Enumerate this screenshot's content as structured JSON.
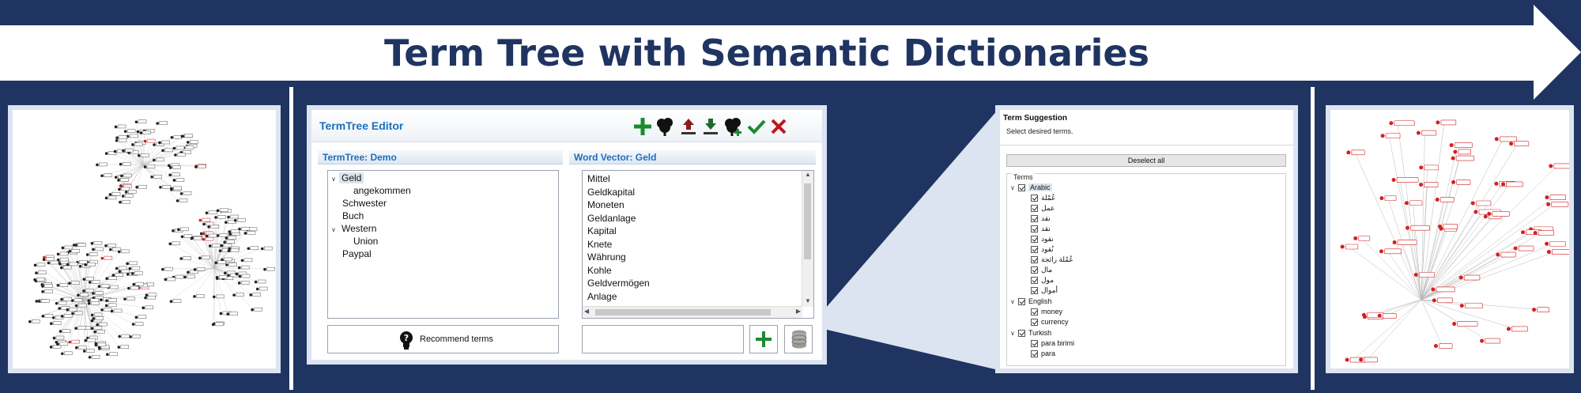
{
  "banner": {
    "title": "Term Tree with Semantic Dictionaries"
  },
  "editor": {
    "title": "TermTree Editor",
    "toolbar": [
      "add-icon",
      "tree-icon",
      "upload-icon",
      "download-icon",
      "tree-add-icon",
      "check-icon",
      "close-icon"
    ],
    "colors": {
      "title": "#1a6fbf",
      "add": "#1a8c2e",
      "check": "#1a8c2e",
      "close": "#c0161d",
      "upload": "#8b1a1a",
      "download": "#1a6a2e"
    },
    "tree_header": "TermTree: Demo",
    "word_vector_header": "Word Vector: Geld",
    "tree": [
      {
        "label": "Geld",
        "level": 0,
        "expanded": true,
        "selected": true
      },
      {
        "label": "angekommen",
        "level": 1
      },
      {
        "label": "Schwester",
        "level": 0
      },
      {
        "label": "Buch",
        "level": 0
      },
      {
        "label": "Western",
        "level": 0,
        "expanded": true
      },
      {
        "label": "Union",
        "level": 1
      },
      {
        "label": "Paypal",
        "level": 0
      }
    ],
    "word_vector": [
      "Mittel",
      "Geldkapital",
      "Moneten",
      "Geldanlage",
      "Kapital",
      "Knete",
      "Währung",
      "Kohle",
      "Geldvermögen",
      "Anlage"
    ],
    "recommend_label": "Recommend terms",
    "new_term_value": ""
  },
  "suggestion": {
    "title": "Term Suggestion",
    "subtitle": "Select desired terms.",
    "deselect_label": "Deselect all",
    "terms_label": "Terms",
    "groups": [
      {
        "name": "Arabic",
        "items": [
          "عُمْلة",
          "عمل",
          "نقد",
          "نقد",
          "نقود",
          "نُقود",
          "عُمْلة رائجة",
          "مال",
          "مول",
          "أموال"
        ]
      },
      {
        "name": "English",
        "items": [
          "money",
          "currency"
        ]
      },
      {
        "name": "Turkish",
        "items": [
          "para birimi",
          "para"
        ]
      }
    ]
  },
  "graph_colors": {
    "node": "#555555",
    "highlight": "#d42020",
    "edge": "#bbbbbb"
  }
}
